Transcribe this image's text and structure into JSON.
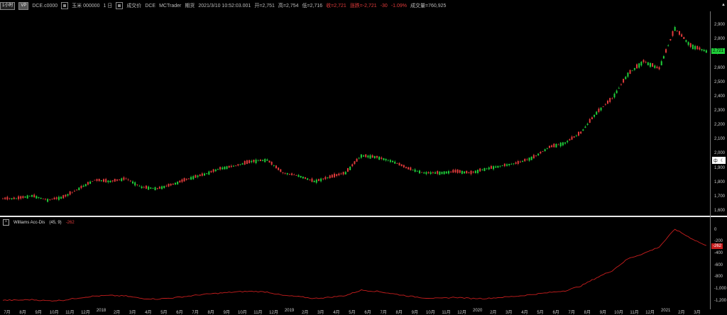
{
  "header": {
    "period_button": "1小时",
    "vp_label": "VP",
    "symbol": "DCE.c0000",
    "name": "玉米 000000",
    "interval": "1 日",
    "price_type": "成交价",
    "exchange": "DCE",
    "platform": "MCTrader",
    "category": "期货",
    "datetime": "2021/3/10   10:52:03.001",
    "open": "开=2,751",
    "high": "高=2,754",
    "low": "低=2,716",
    "close": "收=2,721",
    "change": "涨跌=-2,721",
    "change2": "-30",
    "pct": "-1.09%",
    "volume": "成交量=760,925"
  },
  "colors": {
    "up": "#1fcf3a",
    "down": "#e23b3b",
    "indicator": "#c81e1e"
  },
  "price_axis": [
    "2,900",
    "2,800",
    "2,700",
    "2,600",
    "2,500",
    "2,400",
    "2,300",
    "2,200",
    "2,100",
    "2,000",
    "1,900",
    "1,800",
    "1,700",
    "1,600"
  ],
  "price_tag": "2,721",
  "lang_box": {
    "text": "中",
    "icon": "moon-icon"
  },
  "indicator": {
    "name": "Williams Acc-Dis",
    "params": "(45, 9)",
    "value": "-262",
    "axis": [
      "0",
      "-200",
      "-400",
      "-600",
      "-800",
      "-1,000",
      "-1,200"
    ]
  },
  "x_axis": [
    "7月",
    "8月",
    "9月",
    "10月",
    "11月",
    "12月",
    "2018",
    "2月",
    "3月",
    "4月",
    "5月",
    "6月",
    "7月",
    "8月",
    "9月",
    "10月",
    "11月",
    "12月",
    "2019",
    "2月",
    "3月",
    "4月",
    "5月",
    "6月",
    "7月",
    "8月",
    "9月",
    "10月",
    "11月",
    "12月",
    "2020",
    "2月",
    "3月",
    "4月",
    "5月",
    "6月",
    "7月",
    "8月",
    "9月",
    "10月",
    "11月",
    "12月",
    "2021",
    "2月",
    "3月"
  ],
  "chart_data": [
    {
      "type": "candlestick",
      "title": "DCE.c0000 玉米 1 日",
      "x": [
        "2017-07",
        "2017-08",
        "2017-09",
        "2017-10",
        "2017-11",
        "2017-12",
        "2018-01",
        "2018-02",
        "2018-03",
        "2018-04",
        "2018-05",
        "2018-06",
        "2018-07",
        "2018-08",
        "2018-09",
        "2018-10",
        "2018-11",
        "2018-12",
        "2019-01",
        "2019-02",
        "2019-03",
        "2019-04",
        "2019-05",
        "2019-06",
        "2019-07",
        "2019-08",
        "2019-09",
        "2019-10",
        "2019-11",
        "2019-12",
        "2020-01",
        "2020-02",
        "2020-03",
        "2020-04",
        "2020-05",
        "2020-06",
        "2020-07",
        "2020-08",
        "2020-09",
        "2020-10",
        "2020-11",
        "2020-12",
        "2021-01",
        "2021-02",
        "2021-03"
      ],
      "close": [
        1690,
        1710,
        1680,
        1700,
        1760,
        1820,
        1810,
        1830,
        1770,
        1760,
        1790,
        1830,
        1860,
        1900,
        1920,
        1950,
        1960,
        1870,
        1850,
        1810,
        1840,
        1870,
        1990,
        1980,
        1950,
        1900,
        1870,
        1870,
        1880,
        1870,
        1900,
        1920,
        1940,
        1980,
        2050,
        2080,
        2150,
        2290,
        2390,
        2560,
        2650,
        2600,
        2880,
        2760,
        2721
      ],
      "ylim": [
        1600,
        2950
      ]
    },
    {
      "type": "line",
      "title": "Williams Acc-Dis (45, 9)",
      "x": [
        "2017-07",
        "2017-08",
        "2017-09",
        "2017-10",
        "2017-11",
        "2017-12",
        "2018-01",
        "2018-02",
        "2018-03",
        "2018-04",
        "2018-05",
        "2018-06",
        "2018-07",
        "2018-08",
        "2018-09",
        "2018-10",
        "2018-11",
        "2018-12",
        "2019-01",
        "2019-02",
        "2019-03",
        "2019-04",
        "2019-05",
        "2019-06",
        "2019-07",
        "2019-08",
        "2019-09",
        "2019-10",
        "2019-11",
        "2019-12",
        "2020-01",
        "2020-02",
        "2020-03",
        "2020-04",
        "2020-05",
        "2020-06",
        "2020-07",
        "2020-08",
        "2020-09",
        "2020-10",
        "2020-11",
        "2020-12",
        "2021-01",
        "2021-02",
        "2021-03"
      ],
      "values": [
        -1180,
        -1170,
        -1190,
        -1180,
        -1140,
        -1110,
        -1100,
        -1110,
        -1150,
        -1160,
        -1140,
        -1110,
        -1080,
        -1060,
        -1040,
        -1030,
        -1040,
        -1100,
        -1120,
        -1150,
        -1130,
        -1100,
        -1010,
        -1030,
        -1070,
        -1110,
        -1140,
        -1150,
        -1130,
        -1150,
        -1150,
        -1130,
        -1110,
        -1080,
        -1050,
        -1020,
        -940,
        -800,
        -680,
        -480,
        -390,
        -280,
        20,
        -130,
        -262
      ],
      "ylim": [
        -1250,
        80
      ]
    }
  ]
}
